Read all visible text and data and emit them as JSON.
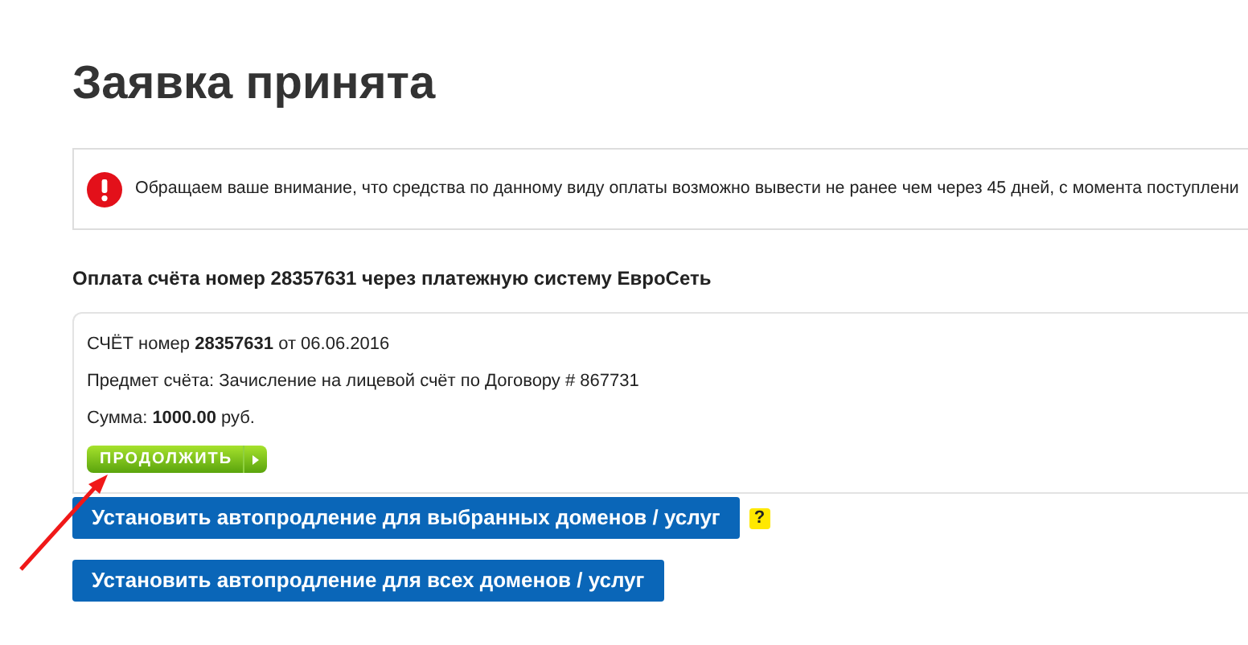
{
  "title": "Заявка принята",
  "notice": {
    "text": "Обращаем ваше внимание, что средства по данному виду оплаты возможно вывести не ранее чем через 45 дней, с момента поступлени"
  },
  "payment_heading": "Оплата счёта номер 28357631 через платежную систему ЕвроСеть",
  "invoice": {
    "line_1": "СЧЁТ номер **28357631** от 06.06.2016",
    "line_2": "Предмет счёта: Зачисление на лицевой счёт по Договору # 867731",
    "line_3": "Сумма: **1000.00** руб.",
    "continue_button": "ПРОДОЛЖИТЬ"
  },
  "buttons": [
    {
      "label": "Установить автопродление для выбранных доменов / услуг",
      "help": "?"
    },
    {
      "label": "Установить автопродление для всех доменов / услуг"
    }
  ]
}
